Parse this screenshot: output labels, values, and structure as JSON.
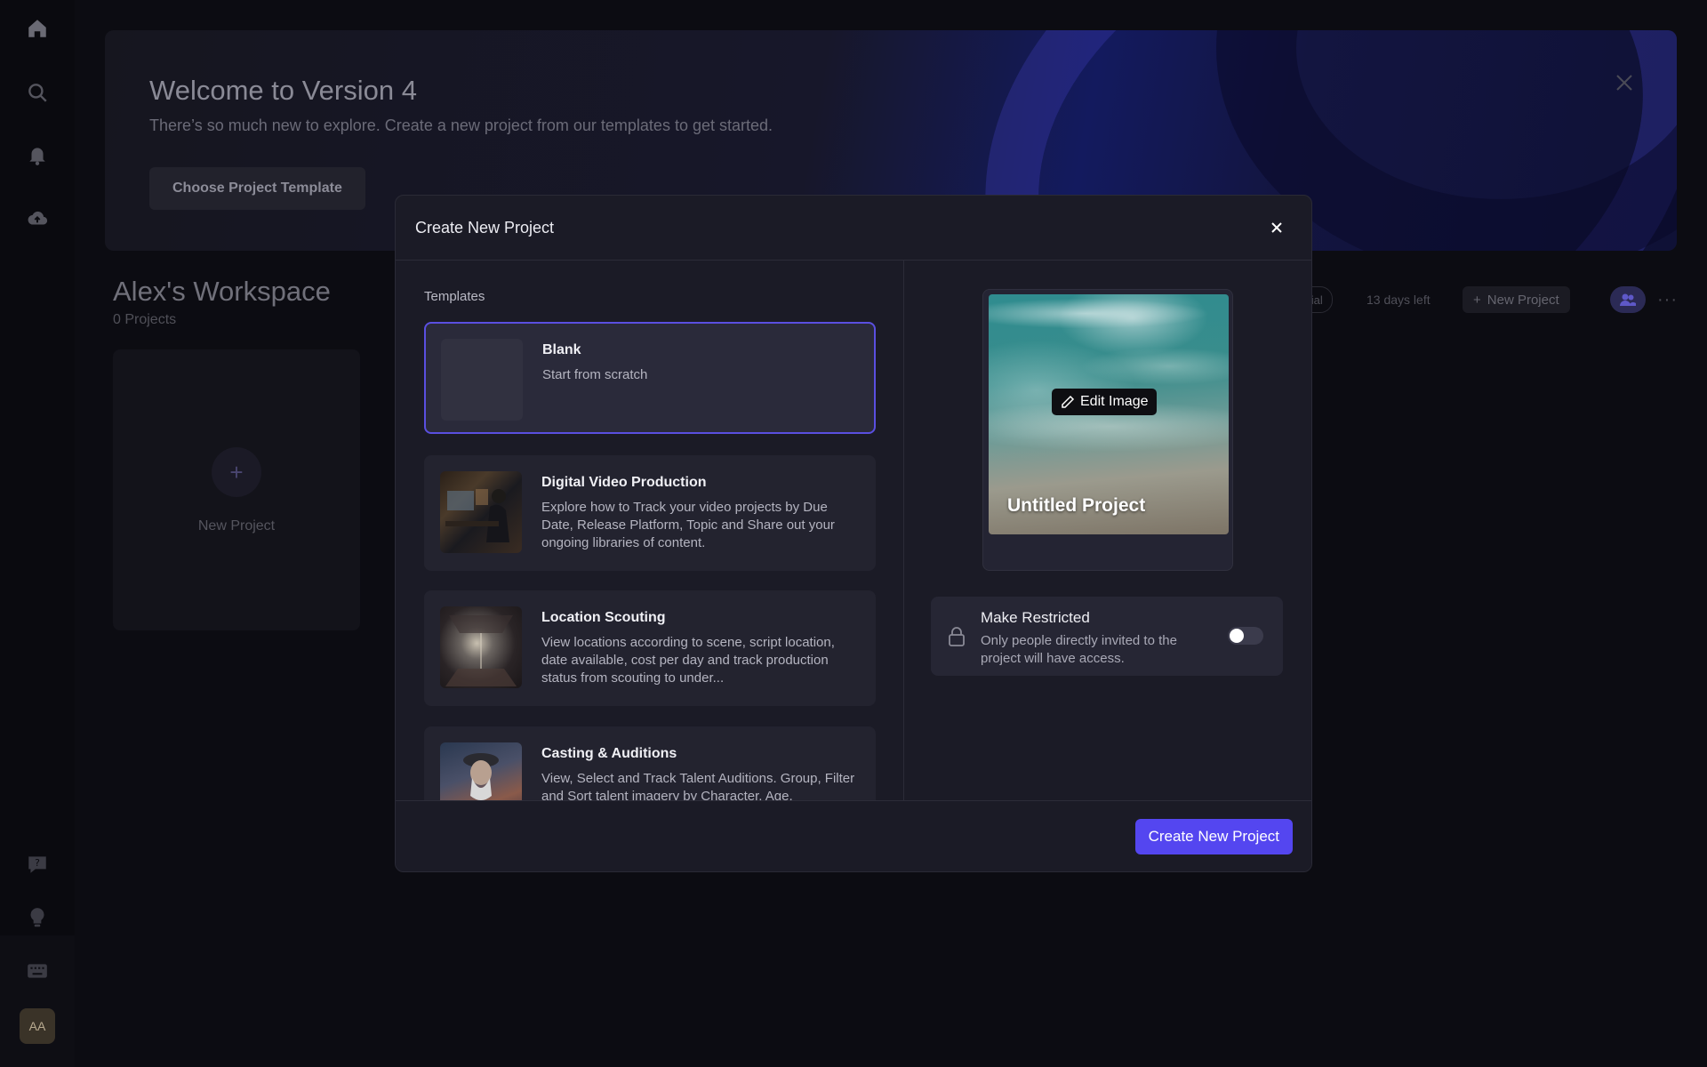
{
  "banner": {
    "title": "Welcome to Version 4",
    "subtitle": "There’s so much new to explore. Create a new project from our templates to get started.",
    "button_label": "Choose Project Template"
  },
  "workspace": {
    "title": "Alex's Workspace",
    "project_count": "0 Projects",
    "new_project_card_label": "New Project",
    "trial_badge": "Trial",
    "days_left": "13 days left",
    "new_project_button": "New Project",
    "more_label": "···"
  },
  "sidebar": {
    "avatar_initials": "AA",
    "icons": [
      "home-icon",
      "search-icon",
      "bell-icon",
      "cloud-upload-icon",
      "help-icon",
      "lightbulb-icon",
      "keyboard-icon"
    ]
  },
  "modal": {
    "title": "Create New Project",
    "templates_label": "Templates",
    "templates": [
      {
        "name": "Blank",
        "description": "Start from scratch",
        "selected": true
      },
      {
        "name": "Digital Video Production",
        "description": "Explore how to Track your video projects by Due Date, Release Platform, Topic and Share out your ongoing libraries of content."
      },
      {
        "name": "Location Scouting",
        "description": "View locations according to scene, script location, date available, cost per day and track production status from scouting to under..."
      },
      {
        "name": "Casting & Auditions",
        "description": "View, Select and Track Talent Auditions. Group, Filter and Sort talent imagery by Character, Age,"
      }
    ],
    "preview": {
      "edit_image_label": "Edit Image",
      "project_title": "Untitled Project"
    },
    "restricted": {
      "title": "Make Restricted",
      "description": "Only people directly invited to the project will have access.",
      "enabled": false
    },
    "create_button": "Create New Project"
  },
  "colors": {
    "accent": "#5446f0",
    "selected_border": "#5a4fe0",
    "modal_bg": "#1b1b26"
  }
}
